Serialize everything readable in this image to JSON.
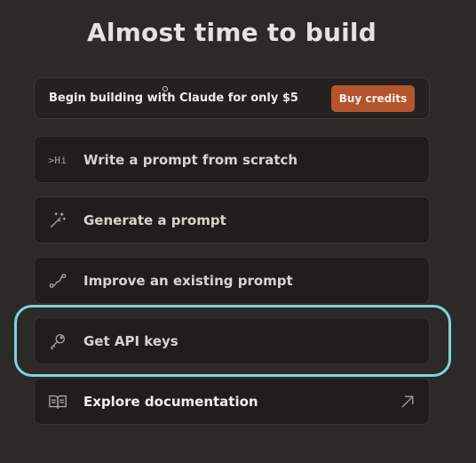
{
  "title": "Almost time to build",
  "banner": {
    "text": "Begin building with Claude for only $5",
    "button_label": "Buy credits"
  },
  "options": [
    {
      "label": "Write a prompt from scratch",
      "icon": "terminal-hi-icon",
      "icon_text": ">Hi"
    },
    {
      "label": "Generate a prompt",
      "icon": "magic-wand-icon"
    },
    {
      "label": "Improve an existing prompt",
      "icon": "route-icon"
    },
    {
      "label": "Get API keys",
      "icon": "key-icon"
    },
    {
      "label": "Explore documentation",
      "icon": "book-icon",
      "trailing_icon": "external-arrow-icon"
    }
  ],
  "colors": {
    "background": "#2b2a29",
    "card": "#1f1e1d",
    "accent_button": "#b4552e",
    "highlight": "#7fd4d8"
  }
}
